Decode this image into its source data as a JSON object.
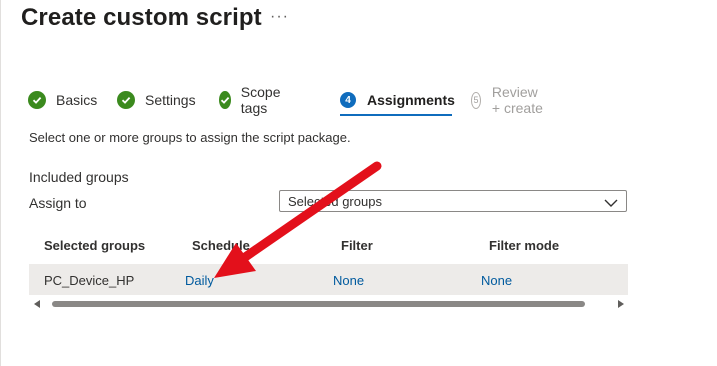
{
  "header": {
    "title": "Create custom script",
    "more": "···"
  },
  "wizard": {
    "steps": [
      {
        "label": "Basics",
        "state": "completed"
      },
      {
        "label": "Settings",
        "state": "completed"
      },
      {
        "label": "Scope tags",
        "state": "completed"
      },
      {
        "label": "Assignments",
        "number": "4",
        "state": "active"
      },
      {
        "label": "Review + create",
        "number": "5",
        "state": "disabled"
      }
    ]
  },
  "assignments": {
    "instructions": "Select one or more groups to assign the script package.",
    "included_groups_label": "Included groups",
    "assign_to_label": "Assign to",
    "assign_to_value": "Selected groups",
    "table": {
      "headers": [
        "Selected groups",
        "Schedule",
        "Filter",
        "Filter mode"
      ],
      "rows": [
        {
          "group": "PC_Device_HP",
          "schedule": "Daily",
          "filter": "None",
          "filter_mode": "None"
        }
      ]
    }
  },
  "colors": {
    "accent": "#0f6cbd",
    "success": "#3b8a1e",
    "link": "#005a9e",
    "annotation": "#e3101b"
  }
}
